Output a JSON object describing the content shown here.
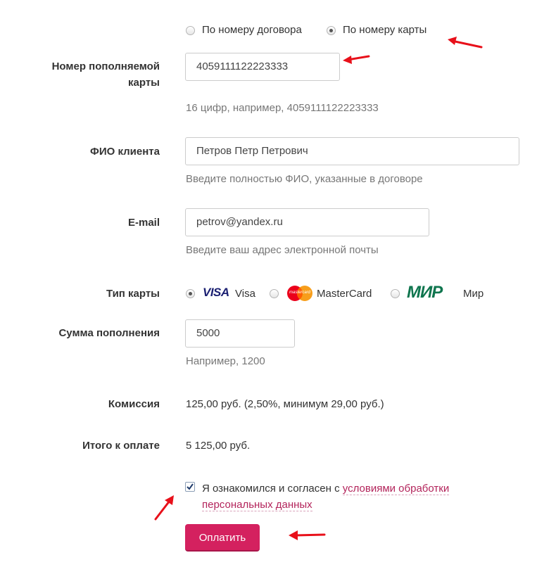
{
  "search_type": {
    "options": [
      "По номеру договора",
      "По номеру карты"
    ],
    "selected": "По номеру карты"
  },
  "card_number": {
    "label": "Номер пополняемой карты",
    "value": "4059111122223333",
    "hint": "16 цифр, например, 4059111122223333"
  },
  "client_name": {
    "label": "ФИО клиента",
    "value": "Петров Петр Петрович",
    "hint": "Введите полностью ФИО, указанные в договоре"
  },
  "email": {
    "label": "E-mail",
    "value": "petrov@yandex.ru",
    "hint": "Введите ваш адрес электронной почты"
  },
  "card_type": {
    "label": "Тип карты",
    "options": [
      {
        "logo": "VISA",
        "label": "Visa"
      },
      {
        "logo": "mastercard",
        "label": "MasterCard"
      },
      {
        "logo": "МИР",
        "label": "Мир"
      }
    ],
    "selected": "Visa"
  },
  "amount": {
    "label": "Сумма пополнения",
    "value": "5000",
    "hint": "Например, 1200"
  },
  "commission": {
    "label": "Комиссия",
    "value": "125,00 руб. (2,50%, минимум 29,00 руб.)"
  },
  "total": {
    "label": "Итого к оплате",
    "value": "5 125,00 руб."
  },
  "agreement": {
    "checked": true,
    "text": "Я ознакомился и согласен с",
    "link_text": "условиями обработки персональных данных"
  },
  "pay_button": "Оплатить",
  "colors": {
    "accent": "#d4215f",
    "link": "#b3245b",
    "annotation_arrow": "#e8101a"
  }
}
